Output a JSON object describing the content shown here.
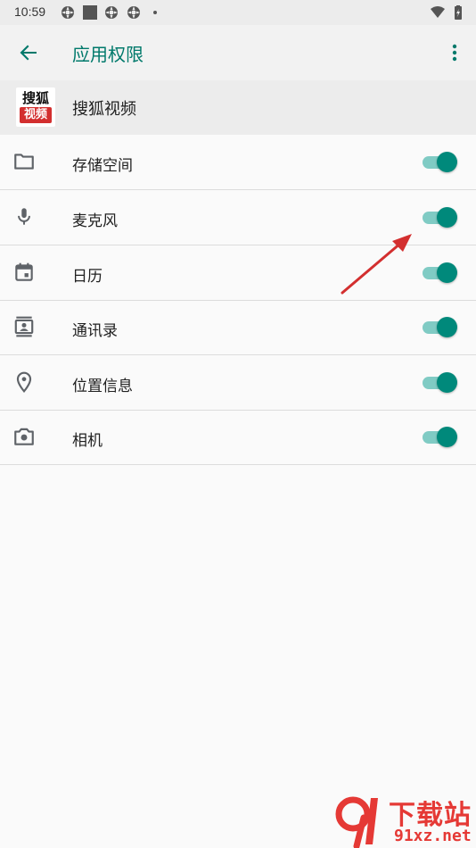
{
  "status_bar": {
    "time": "10:59",
    "icons": [
      "app-notification-icon",
      "square-notification-icon",
      "app-notification-icon",
      "app-notification-icon",
      "dot-icon",
      "wifi-icon",
      "battery-charging-icon"
    ]
  },
  "app_bar": {
    "title": "应用权限",
    "back_icon": "arrow-back-icon",
    "menu_icon": "more-vert-icon",
    "accent": "#00796b"
  },
  "app": {
    "name": "搜狐视频",
    "logo_top": "搜狐",
    "logo_bottom": "视频"
  },
  "permissions": [
    {
      "label": "存储空间",
      "icon": "folder-icon",
      "enabled": true
    },
    {
      "label": "麦克风",
      "icon": "microphone-icon",
      "enabled": true
    },
    {
      "label": "日历",
      "icon": "calendar-icon",
      "enabled": true
    },
    {
      "label": "通讯录",
      "icon": "contacts-icon",
      "enabled": true
    },
    {
      "label": "位置信息",
      "icon": "location-icon",
      "enabled": true
    },
    {
      "label": "相机",
      "icon": "camera-icon",
      "enabled": true
    }
  ],
  "colors": {
    "toggle_thumb": "#00897b",
    "toggle_track": "#80cbc4",
    "annotation_arrow": "#d32f2f"
  },
  "watermark": {
    "top": "下载站",
    "bottom": "91xz.net"
  }
}
